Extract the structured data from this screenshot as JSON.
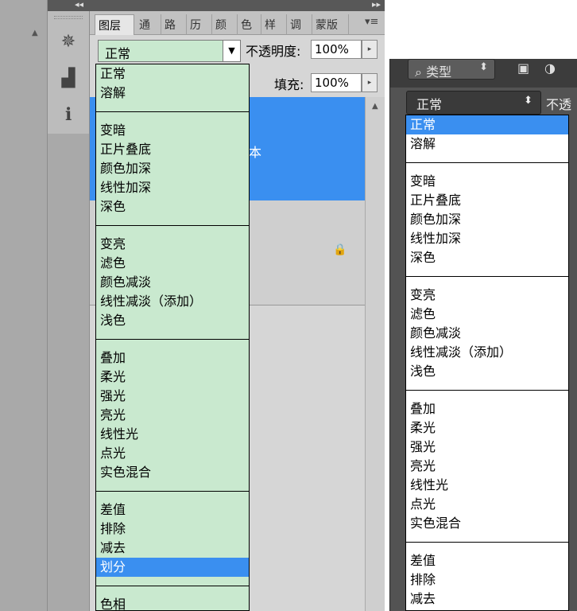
{
  "top_strip": {
    "collapse_glyph": "◂◂",
    "expand_glyph": "▸▸"
  },
  "left_edge": {
    "scroll_up": "▲"
  },
  "icon_column": [
    {
      "name": "navigator-wheel-icon",
      "glyph": "✵"
    },
    {
      "name": "histogram-icon",
      "glyph": "▟"
    },
    {
      "name": "info-icon",
      "glyph": "ℹ"
    }
  ],
  "tabs": [
    {
      "label": "图层",
      "active": true
    },
    {
      "label": "通",
      "active": false
    },
    {
      "label": "路",
      "active": false
    },
    {
      "label": "历",
      "active": false
    },
    {
      "label": "颜",
      "active": false
    },
    {
      "label": "色",
      "active": false
    },
    {
      "label": "样",
      "active": false
    },
    {
      "label": "调",
      "active": false
    },
    {
      "label": "蒙版",
      "active": false
    }
  ],
  "tab_menu_glyph": "▾≡",
  "layers_panel": {
    "blend_mode": "正常",
    "blend_arrow": "▼",
    "opacity_label": "不透明度:",
    "opacity_value": "100%",
    "fill_label": "填充:",
    "fill_value": "100%",
    "spin_glyph": "▸",
    "selected_layer_partial": "本",
    "lock_glyph": "🔒",
    "scroll_up": "▲"
  },
  "blend_menu_left": {
    "selected": "划分",
    "groups": [
      [
        "正常",
        "溶解"
      ],
      [
        "变暗",
        "正片叠底",
        "颜色加深",
        "线性加深",
        "深色"
      ],
      [
        "变亮",
        "滤色",
        "颜色减淡",
        "线性减淡（添加）",
        "浅色"
      ],
      [
        "叠加",
        "柔光",
        "强光",
        "亮光",
        "线性光",
        "点光",
        "实色混合"
      ],
      [
        "差值",
        "排除",
        "减去",
        "划分"
      ],
      [
        "色相"
      ]
    ]
  },
  "right_panel": {
    "filter_icon": "⌕",
    "filter_label": "类型",
    "filter_spin": "⬍",
    "image_icon": "▣",
    "adjust_icon": "◑",
    "blend_mode": "正常",
    "blend_spin": "⬍",
    "opacity_label": "不透"
  },
  "blend_menu_right": {
    "selected": "正常",
    "groups": [
      [
        "正常",
        "溶解"
      ],
      [
        "变暗",
        "正片叠底",
        "颜色加深",
        "线性加深",
        "深色"
      ],
      [
        "变亮",
        "滤色",
        "颜色减淡",
        "线性减淡（添加）",
        "浅色"
      ],
      [
        "叠加",
        "柔光",
        "强光",
        "亮光",
        "线性光",
        "点光",
        "实色混合"
      ],
      [
        "差值",
        "排除",
        "减去"
      ]
    ]
  },
  "colors": {
    "menu_green": "#c9e9cf",
    "selection_blue": "#3a8ff0",
    "dark_panel": "#535353"
  }
}
